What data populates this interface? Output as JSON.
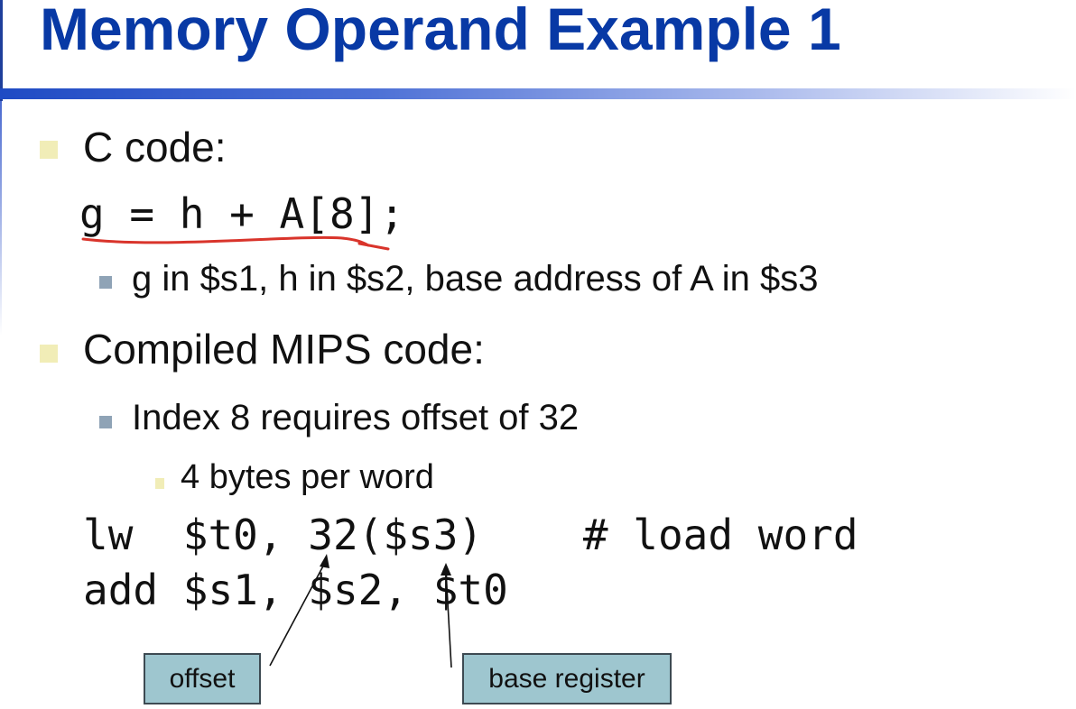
{
  "slide": {
    "title": "Memory Operand Example 1",
    "bullets": {
      "c_code_heading": "C code:",
      "c_code_line": "g = h + A[8];",
      "register_note": "g in $s1, h in $s2, base address of A in $s3",
      "compiled_heading": "Compiled MIPS code:",
      "index_note": "Index 8 requires offset of 32",
      "bytes_note": "4 bytes per word"
    },
    "mips_code": {
      "line1": "lw  $t0, 32($s3)    # load word",
      "line2": "add $s1, $s2, $t0"
    },
    "callouts": {
      "offset": "offset",
      "base_register": "base register"
    },
    "colors": {
      "title": "#0839a5",
      "handwritten_underline": "#d9342b",
      "callout_fill": "#9ec6cf",
      "bullet_level1": "#f1edb7",
      "bullet_level2": "#8fa3b6"
    }
  }
}
